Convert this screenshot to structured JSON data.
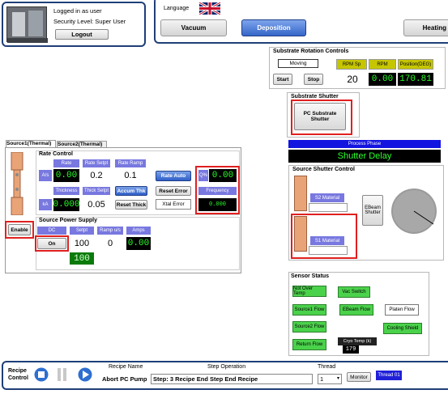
{
  "login": {
    "line1": "Logged in as user",
    "line2": "Security Level: Super User",
    "logout": "Logout"
  },
  "language": {
    "label": "Language"
  },
  "tabs": [
    {
      "label": "Vacuum"
    },
    {
      "label": "Deposition"
    },
    {
      "label": "Heating"
    }
  ],
  "rotation": {
    "title": "Substrate Rotation Controls",
    "status": "Moving",
    "start": "Start",
    "stop": "Stop",
    "rpm_sp_label": "RPM Sp",
    "rpm_label": "RPM",
    "pos_label": "Position(DEG)",
    "rpm_sp": "20",
    "rpm": "0.00",
    "pos": "170.81"
  },
  "shutter": {
    "title": "Substrate Shutter",
    "button": "PC Substrate Shutter"
  },
  "phase": {
    "label": "Process Phase",
    "value": "Shutter Delay"
  },
  "source_shutter": {
    "title": "Source Shutter Control",
    "s2": "S2 Material",
    "s1": "S1 Material",
    "ebeam": "EBeam Shutter"
  },
  "source": {
    "tab1": "Source1(Thermal)",
    "tab2": "Source2(Thermal)",
    "rate_title": "Rate Control",
    "rate_h": "Rate",
    "rate_setpt_h": "Rate Setpt",
    "rate_ramp_h": "Rate Ramp",
    "as_label": "A/s",
    "rate": "0.00",
    "rate_setpt": "0.2",
    "rate_ramp": "0.1",
    "rate_auto": "Rate Auto",
    "q_label": "Q%",
    "q_val": "0.00",
    "thick_h": "Thickness",
    "thick_setpt_h": "Thick Setpt",
    "accum": "Accum Thk",
    "reset_error": "Reset Error",
    "freq_h": "Frequency",
    "ka_label": "kA",
    "thick": "0.000",
    "thick_setpt": "0.05",
    "reset_thick": "Reset Thick",
    "xtal_error": "Xtal Error",
    "freq": "0.000",
    "psu_title": "Source Power Supply",
    "dc_h": "DC",
    "setpt_h": "Setpt",
    "ramp_h": "Ramp u/s",
    "amps_h": "Amps",
    "on": "On",
    "setpt": "100",
    "ramp": "0",
    "amps": "0.00",
    "out": "100",
    "enable": "Enable"
  },
  "sensor": {
    "title": "Sensor Status",
    "not_over_temp": "Not Over Temp",
    "vac_switch": "Vac Switch",
    "s1_flow": "Source1 Flow",
    "ebeam_flow": "EBeam Flow",
    "platen_flow": "Platen Flow",
    "s2_flow": "Source2 Flow",
    "cooling_shield": "Cooling Shield",
    "return_flow": "Return Flow",
    "cryo_label": "Cryo Temp (k)",
    "cryo": "179"
  },
  "recipe": {
    "control": "Recipe Control",
    "name_h": "Recipe Name",
    "step_h": "Step Operation",
    "thread_h": "Thread",
    "name": "Abort PC Pump",
    "step": "Step: 3 Recipe End Step End Recipe",
    "thread": "1",
    "monitor": "Monitor",
    "thread_badge": "Thread 01"
  },
  "colors": {
    "navy": "#1f3f78",
    "purple": "#7878e0",
    "green": "#4bd24b",
    "value_green": "#2aff2a",
    "highlight": "#e02020"
  }
}
